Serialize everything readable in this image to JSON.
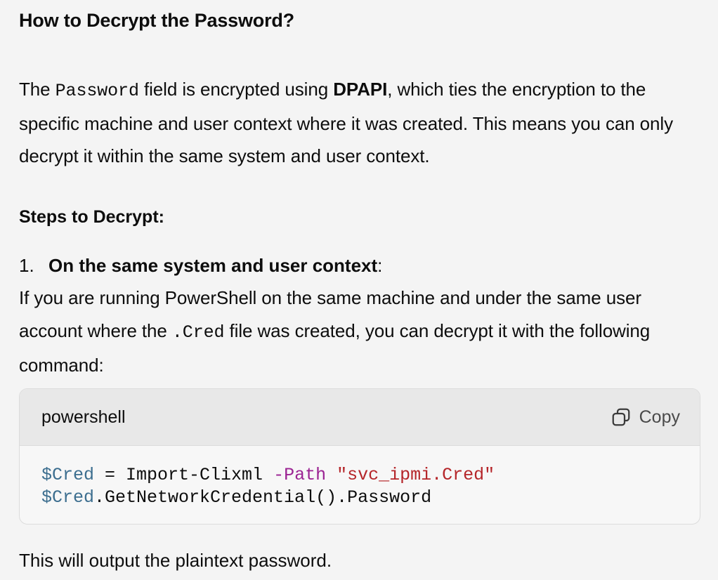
{
  "heading": "How to Decrypt the Password?",
  "intro": {
    "part1": "The ",
    "code1": "Password",
    "part2": " field is encrypted using ",
    "bold1": "DPAPI",
    "part3": ", which ties the encryption to the specific machine and user context where it was created. This means you can only decrypt it within the same system and user context."
  },
  "steps_heading": "Steps to Decrypt:",
  "step1": {
    "number": "1.",
    "title": "On the same system and user context",
    "colon": ":",
    "body_part1": "If you are running PowerShell on the same machine and under the same user account where the ",
    "body_code": ".Cred",
    "body_part2": " file was created, you can decrypt it with the following command:"
  },
  "code_block": {
    "language": "powershell",
    "copy_label": "Copy",
    "line1": {
      "var": "$Cred",
      "op": " = Import-Clixml ",
      "param": "-Path",
      "space": " ",
      "str": "\"svc_ipmi.Cred\""
    },
    "line2": {
      "var": "$Cred",
      "rest": ".GetNetworkCredential().Password"
    }
  },
  "closing": "This will output the plaintext password.",
  "icons": {
    "copy": "copy-icon"
  }
}
